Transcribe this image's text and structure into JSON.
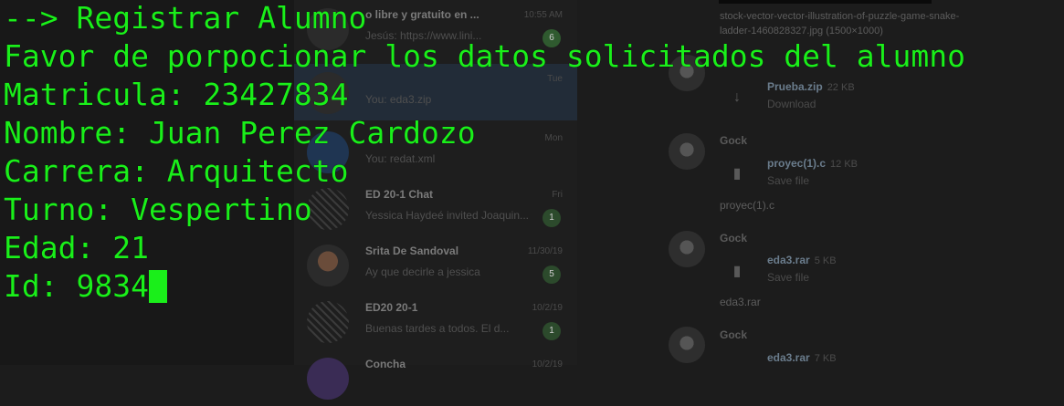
{
  "background": {
    "chats": [
      {
        "title": "o libre y gratuito en ...",
        "preview": "Jesús: https://www.lini...",
        "time": "10:55 AM",
        "badge": "6"
      },
      {
        "title": "",
        "preview": "You: eda3.zip",
        "time": "Tue",
        "badge": ""
      },
      {
        "title": "",
        "preview": "You: redat.xml",
        "time": "Mon",
        "badge": ""
      },
      {
        "title": "ED 20-1 Chat",
        "preview": "Yessica Haydeé invited Joaquin...",
        "time": "Fri",
        "badge": "1"
      },
      {
        "title": "Srita De Sandoval",
        "preview": "Ay que decirle a jessica",
        "time": "11/30/19",
        "badge": "5"
      },
      {
        "title": "ED20 20-1",
        "preview": "Buenas tardes a todos. El d...",
        "time": "10/2/19",
        "badge": "1"
      },
      {
        "title": "Concha",
        "preview": "",
        "time": "10/2/19",
        "badge": ""
      }
    ],
    "right_pane": {
      "caption_top": "stock-vector-vector-illustration-of-puzzle-game-snake-ladder-1460828327.jpg (1500×1000)",
      "files": [
        {
          "sender": "",
          "name": "Prueba.zip",
          "size": "22 KB",
          "action": "Download",
          "caption": ""
        },
        {
          "sender": "Gock",
          "name": "proyec(1).c",
          "size": "12 KB",
          "action": "Save file",
          "caption": "proyec(1).c"
        },
        {
          "sender": "Gock",
          "name": "eda3.rar",
          "size": "5 KB",
          "action": "Save file",
          "caption": "eda3.rar"
        },
        {
          "sender": "Gock",
          "name": "eda3.rar",
          "size": "7 KB",
          "action": "",
          "caption": ""
        }
      ]
    }
  },
  "terminal": {
    "lines": [
      "--> Registrar Alumno",
      "Favor de porpocionar los datos solicitados del alumno",
      "Matricula: 23427834",
      "Nombre: Juan Perez Cardozo",
      "Carrera: Arquitecto",
      "Turno: Vespertino",
      "Edad: 21",
      "Id: 9834"
    ],
    "text_color": "#1aef1a"
  }
}
